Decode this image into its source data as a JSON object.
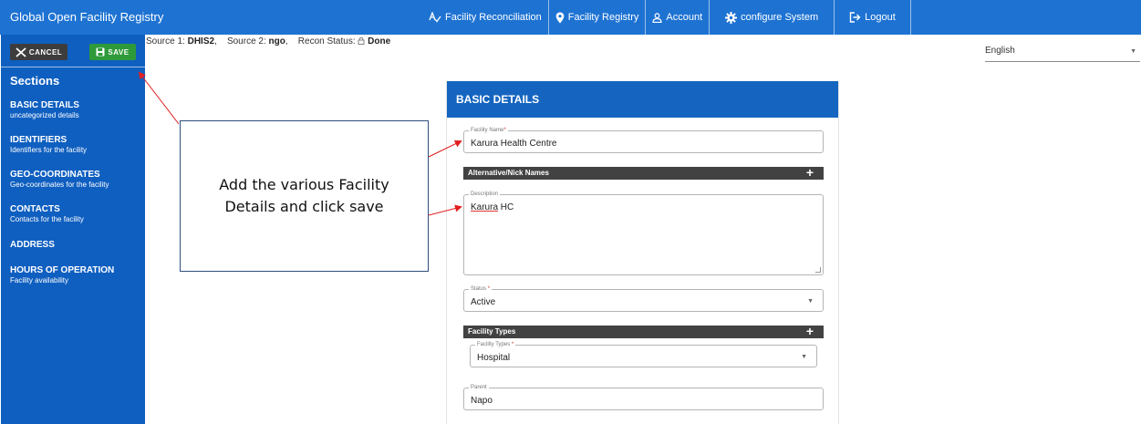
{
  "app": {
    "title": "Global Open Facility Registry"
  },
  "nav": {
    "reconciliation": "Facility Reconciliation",
    "registry": "Facility Registry",
    "account": "Account",
    "configure": "configure System",
    "logout": "Logout"
  },
  "sidebar": {
    "cancel_label": "CANCEL",
    "save_label": "SAVE",
    "sections_title": "Sections",
    "sections": [
      {
        "title": "BASIC DETAILS",
        "subtitle": "uncategorized details"
      },
      {
        "title": "IDENTIFIERS",
        "subtitle": "Identifiers for the facility"
      },
      {
        "title": "GEO-COORDINATES",
        "subtitle": "Geo-coordinates for the facility"
      },
      {
        "title": "CONTACTS",
        "subtitle": "Contacts for the facility"
      },
      {
        "title": "ADDRESS",
        "subtitle": ""
      },
      {
        "title": "HOURS OF OPERATION",
        "subtitle": "Facility availability"
      }
    ]
  },
  "source": {
    "source1_label": "Source 1:",
    "source1_value": "DHIS2",
    "source2_label": "Source 2:",
    "source2_value": "ngo",
    "recon_label": "Recon Status:",
    "recon_value": "Done"
  },
  "language": {
    "selected": "English"
  },
  "form": {
    "header": "BASIC DETAILS",
    "facility_name_label": "Facility Name",
    "facility_name_value": "Karura Health Centre",
    "alt_names_label": "Alternative/Nick Names",
    "description_label": "Description",
    "description_value_underlined": "Karura",
    "description_value_rest": " HC",
    "status_label": "Status",
    "status_value": "Active",
    "facility_types_bar": "Facility Types",
    "facility_types_label": "Facility Types",
    "facility_types_value": "Hospital",
    "parent_label": "Parent",
    "parent_value": "Napo",
    "required_mark": "*"
  },
  "annotation": {
    "text": "Add the various Facility Details and click save"
  },
  "colors": {
    "topbar": "#1e73d2",
    "sidebar": "#0f5fc0",
    "card_header": "#1565c0",
    "save": "#2e9a3a",
    "cancel": "#3d3d3d",
    "arrow": "#e02020"
  },
  "icons": {
    "reconciliation": "spellcheck-icon",
    "registry": "location-pin-icon",
    "account": "user-icon",
    "configure": "gear-icon",
    "logout": "logout-icon",
    "cancel": "tools-icon",
    "save": "floppy-icon",
    "recon": "lock-icon"
  }
}
